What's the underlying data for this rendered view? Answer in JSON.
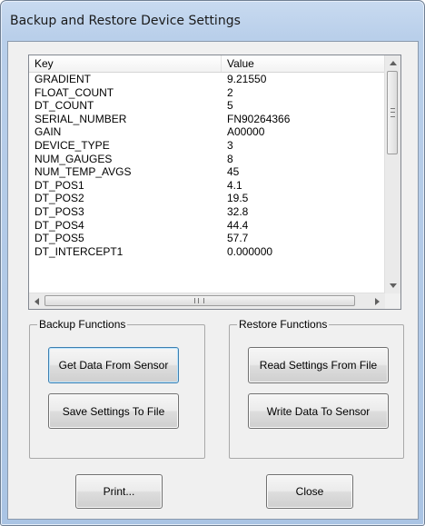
{
  "window": {
    "title": "Backup and Restore Device Settings"
  },
  "list": {
    "columns": {
      "key": "Key",
      "value": "Value"
    },
    "rows": [
      {
        "key": "GRADIENT",
        "value": "9.21550"
      },
      {
        "key": "FLOAT_COUNT",
        "value": "2"
      },
      {
        "key": "DT_COUNT",
        "value": "5"
      },
      {
        "key": "SERIAL_NUMBER",
        "value": "FN90264366"
      },
      {
        "key": "GAIN",
        "value": "A00000"
      },
      {
        "key": "DEVICE_TYPE",
        "value": "3"
      },
      {
        "key": "NUM_GAUGES",
        "value": "8"
      },
      {
        "key": "NUM_TEMP_AVGS",
        "value": "45"
      },
      {
        "key": "DT_POS1",
        "value": "4.1"
      },
      {
        "key": "DT_POS2",
        "value": "19.5"
      },
      {
        "key": "DT_POS3",
        "value": "32.8"
      },
      {
        "key": "DT_POS4",
        "value": "44.4"
      },
      {
        "key": "DT_POS5",
        "value": "57.7"
      },
      {
        "key": "DT_INTERCEPT1",
        "value": "0.000000"
      }
    ]
  },
  "backup": {
    "label": "Backup Functions",
    "get_data": "Get Data From Sensor",
    "save_settings": "Save Settings To File"
  },
  "restore": {
    "label": "Restore Functions",
    "read_settings": "Read Settings From File",
    "write_data": "Write Data To Sensor"
  },
  "footer": {
    "print": "Print...",
    "close": "Close"
  },
  "icons": {
    "scroll_up": "scroll-up-arrow-icon",
    "scroll_down": "scroll-down-arrow-icon",
    "scroll_left": "scroll-left-arrow-icon",
    "scroll_right": "scroll-right-arrow-icon"
  }
}
